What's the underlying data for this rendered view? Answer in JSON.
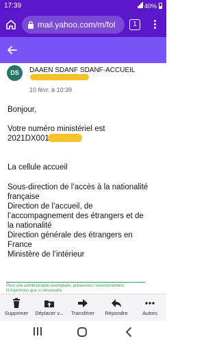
{
  "status_bar": {
    "time": "17:39",
    "battery": "40%"
  },
  "browser": {
    "url": "mail.yahoo.com/m/fol",
    "tab_count": "1"
  },
  "message": {
    "sender": "DAAEN SDANF SDANF-ACCUEIL",
    "avatar_initials": "DS",
    "date": "10 févr. à 10:39",
    "greeting": "Bonjour,",
    "line1": "Votre numéro ministériel est",
    "number_prefix": "2021DX001",
    "signoff": "La cellule accueil",
    "sig1": "Sous-direction de l’accès à la nationalité",
    "sig2": "française",
    "sig3": "Direction de l’accueil, de",
    "sig4": "l’accompagnement des étrangers et de",
    "sig5": "la nationalité",
    "sig6": "Direction générale des étrangers en",
    "sig7": "France",
    "sig8": "Ministère de l’intérieur",
    "footer_line1": "Pour une administration exemplaire, préservons l'environnement.",
    "footer_line2": "N'imprimons que si nécessaire."
  },
  "actions": {
    "delete": "Supprimer",
    "move": "Déplacer v...",
    "forward": "Transférer",
    "reply": "Répondre",
    "more": "Autres"
  },
  "colors": {
    "browser_bar": "#5b17c9",
    "app_bar": "#7b54f7",
    "redaction": "#f6c32c",
    "avatar": "#26766a"
  }
}
